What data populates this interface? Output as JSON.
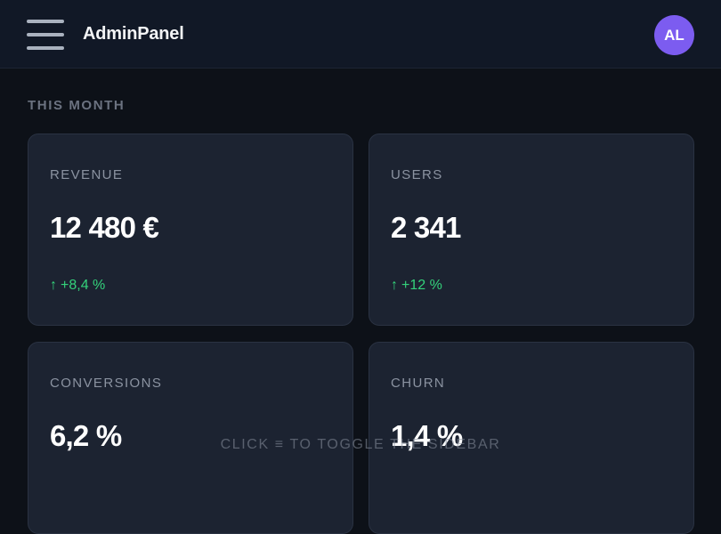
{
  "header": {
    "app_title": "AdminPanel",
    "avatar_initials": "AL"
  },
  "section": {
    "label": "THIS MONTH"
  },
  "cards": [
    {
      "label": "REVENUE",
      "value": "12 480 €",
      "delta_arrow": "↑",
      "delta": "+8,4 %"
    },
    {
      "label": "USERS",
      "value": "2 341",
      "delta_arrow": "↑",
      "delta": "+12 %"
    },
    {
      "label": "CONVERSIONS",
      "value": "6,2 %"
    },
    {
      "label": "CHURN",
      "value": "1,4 %"
    }
  ],
  "hint": "CLICK ≡ TO TOGGLE THE SIDEBAR",
  "colors": {
    "accent_avatar": "#7c5cf0",
    "positive": "#34d27b",
    "card_bg": "#1c2331",
    "page_bg": "#0d1118"
  },
  "icons": {
    "menu": "hamburger-menu-icon",
    "delta_up": "arrow-up-icon"
  }
}
